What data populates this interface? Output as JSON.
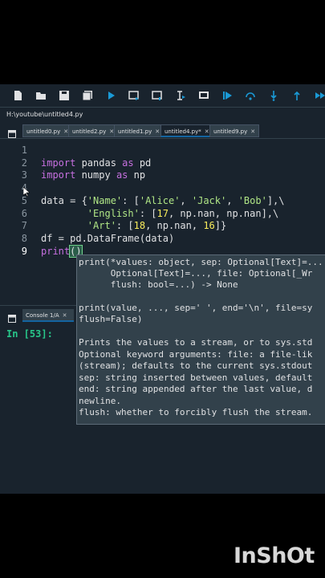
{
  "window": {
    "file_path": "H:\\youtube\\untitled4.py"
  },
  "toolbar": {
    "icons": [
      "new-file-icon",
      "open-folder-icon",
      "save-icon",
      "save-all-icon",
      "run-icon",
      "run-cell-icon",
      "run-cell-advance-icon",
      "run-selection-icon",
      "debug-cursor-icon",
      "debug-icon",
      "step-icon",
      "step-into-icon",
      "step-return-icon",
      "continue-icon"
    ]
  },
  "tabs": [
    {
      "label": "untitled0.py",
      "active": false
    },
    {
      "label": "untitled2.py",
      "active": false
    },
    {
      "label": "untitled1.py",
      "active": false
    },
    {
      "label": "untitled4.py*",
      "active": true
    },
    {
      "label": "untitled9.py",
      "active": false
    }
  ],
  "close_glyph": "✕",
  "editor": {
    "line_numbers": [
      "1",
      "2",
      "3",
      "4",
      "5",
      "6",
      "7",
      "8",
      "9"
    ],
    "current_line": "9",
    "l2": {
      "kw1": "import",
      "mod": " pandas ",
      "kw2": "as",
      "alias": " pd"
    },
    "l3": {
      "kw1": "import",
      "mod": " numpy ",
      "kw2": "as",
      "alias": " np"
    },
    "l5": {
      "a": "data = {",
      "s1": "'Name'",
      "b": ": [",
      "s2": "'Alice'",
      "c": ", ",
      "s3": "'Jack'",
      "d": ", ",
      "s4": "'Bob'",
      "e": "],\\"
    },
    "l6": {
      "a": "        ",
      "s1": "'English'",
      "b": ": [",
      "n1": "17",
      "c": ", np.nan, np.nan],\\"
    },
    "l7": {
      "a": "        ",
      "s1": "'Art'",
      "b": ": [",
      "n1": "18",
      "c": ", np.nan, ",
      "n2": "16",
      "d": "]}"
    },
    "l8": "df = pd.DataFrame(data)",
    "l9": {
      "fn": "print",
      "paren": "()"
    }
  },
  "calltip": {
    "lines": [
      "print(*values: object, sep: Optional[Text]=...",
      "      Optional[Text]=..., file: Optional[_Wr",
      "      flush: bool=...) -> None",
      "",
      "print(value, ..., sep=' ', end='\\n', file=sy",
      "flush=False)",
      "",
      "Prints the values to a stream, or to sys.std",
      "Optional keyword arguments: file: a file-lik",
      "(stream); defaults to the current sys.stdout",
      "sep: string inserted between values, default",
      "end: string appended after the last value, d",
      "newline.",
      "flush: whether to forcibly flush the stream."
    ]
  },
  "console": {
    "tab_label": "Console 1/A",
    "prompt": "In [53]:"
  },
  "watermark": "InShOt",
  "colors": {
    "bg": "#19232d",
    "keyword": "#c670e0",
    "string": "#b0e686",
    "number": "#faed5c",
    "prompt": "#28c78a",
    "accent": "#1464a0"
  }
}
